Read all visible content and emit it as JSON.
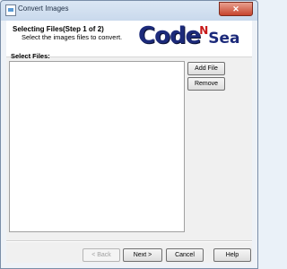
{
  "window": {
    "title": "Convert Images",
    "close_label": "✕"
  },
  "header": {
    "step_title": "Selecting Files(Step 1 of 2)",
    "step_subtitle": "Select the images files to convert.",
    "logo": {
      "part1": "Code",
      "part2": "N",
      "part3": "Sea"
    }
  },
  "files": {
    "label": "Select Files:",
    "items": []
  },
  "side_buttons": {
    "add_file": "Add File",
    "remove": "Remove"
  },
  "footer": {
    "back": "< Back",
    "next": "Next >",
    "cancel": "Cancel",
    "help": "Help"
  },
  "colors": {
    "logo_blue": "#1c2a7a",
    "logo_red": "#c81818",
    "close_red": "#c7442d"
  }
}
